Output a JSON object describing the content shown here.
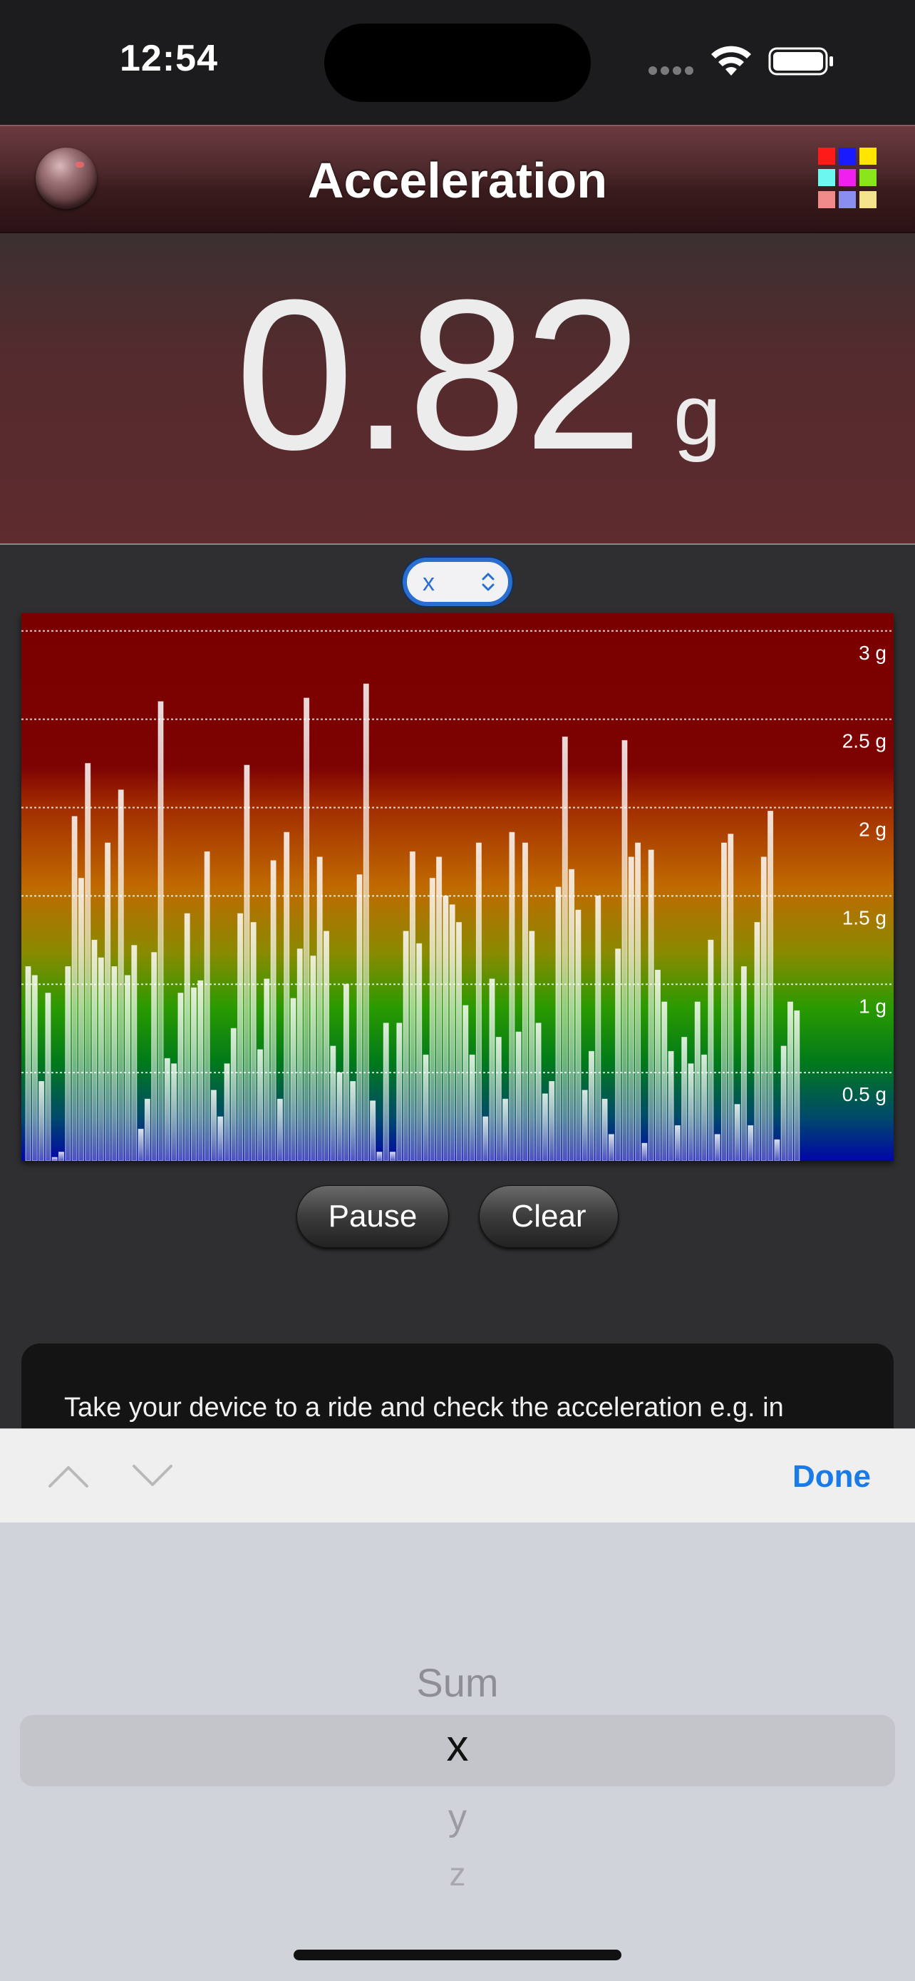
{
  "status_bar": {
    "time": "12:54"
  },
  "nav": {
    "title": "Acceleration",
    "grid_colors": [
      "#ff1a1a",
      "#1a1aff",
      "#ffe600",
      "#6cf7f0",
      "#f020f0",
      "#88e61a",
      "#f08a8a",
      "#8a8ef0",
      "#f5e38c"
    ]
  },
  "reading": {
    "value": "0.82",
    "unit": "g"
  },
  "axis_selector": {
    "value": "x"
  },
  "chart_data": {
    "type": "bar",
    "y_unit": "g",
    "ylim": [
      0,
      3.1
    ],
    "y_ticks": [
      {
        "value": 3,
        "label": "3 g"
      },
      {
        "value": 2.5,
        "label": "2.5 g"
      },
      {
        "value": 2,
        "label": "2 g"
      },
      {
        "value": 1.5,
        "label": "1.5 g"
      },
      {
        "value": 1,
        "label": "1 g"
      },
      {
        "value": 0.5,
        "label": "0.5 g"
      }
    ],
    "grid": true,
    "values": [
      1.1,
      1.05,
      0.45,
      0.95,
      0.02,
      0.05,
      1.1,
      1.95,
      1.6,
      2.25,
      1.25,
      1.15,
      1.8,
      1.1,
      2.1,
      1.05,
      1.22,
      0.18,
      0.35,
      1.18,
      2.6,
      0.58,
      0.55,
      0.95,
      1.4,
      0.98,
      1.02,
      1.75,
      0.4,
      0.25,
      0.55,
      0.75,
      1.4,
      2.24,
      1.35,
      0.63,
      1.03,
      1.7,
      0.35,
      1.86,
      0.92,
      1.2,
      2.62,
      1.16,
      1.72,
      1.3,
      0.65,
      0.5,
      1.0,
      0.45,
      1.62,
      2.7,
      0.34,
      0.05,
      0.78,
      0.05,
      0.78,
      1.3,
      1.75,
      1.23,
      0.6,
      1.6,
      1.72,
      1.5,
      1.45,
      1.35,
      0.88,
      0.6,
      1.8,
      0.25,
      1.03,
      0.7,
      0.35,
      1.86,
      0.73,
      1.8,
      1.3,
      0.78,
      0.38,
      0.45,
      1.55,
      2.4,
      1.65,
      1.42,
      0.4,
      0.62,
      1.5,
      0.35,
      0.15,
      1.2,
      2.38,
      1.72,
      1.8,
      0.1,
      1.76,
      1.08,
      0.9,
      0.62,
      0.2,
      0.7,
      0.55,
      0.9,
      0.6,
      1.25,
      0.15,
      1.8,
      1.85,
      0.32,
      1.1,
      0.2,
      1.35,
      1.72,
      1.98,
      0.12,
      0.65,
      0.9,
      0.85
    ]
  },
  "buttons": {
    "pause": "Pause",
    "clear": "Clear"
  },
  "info": {
    "text": "Take your device to a ride and check the acceleration e.g. in"
  },
  "accessory": {
    "done": "Done"
  },
  "picker": {
    "options": [
      "Sum",
      "x",
      "y",
      "z"
    ],
    "selected": "x"
  }
}
